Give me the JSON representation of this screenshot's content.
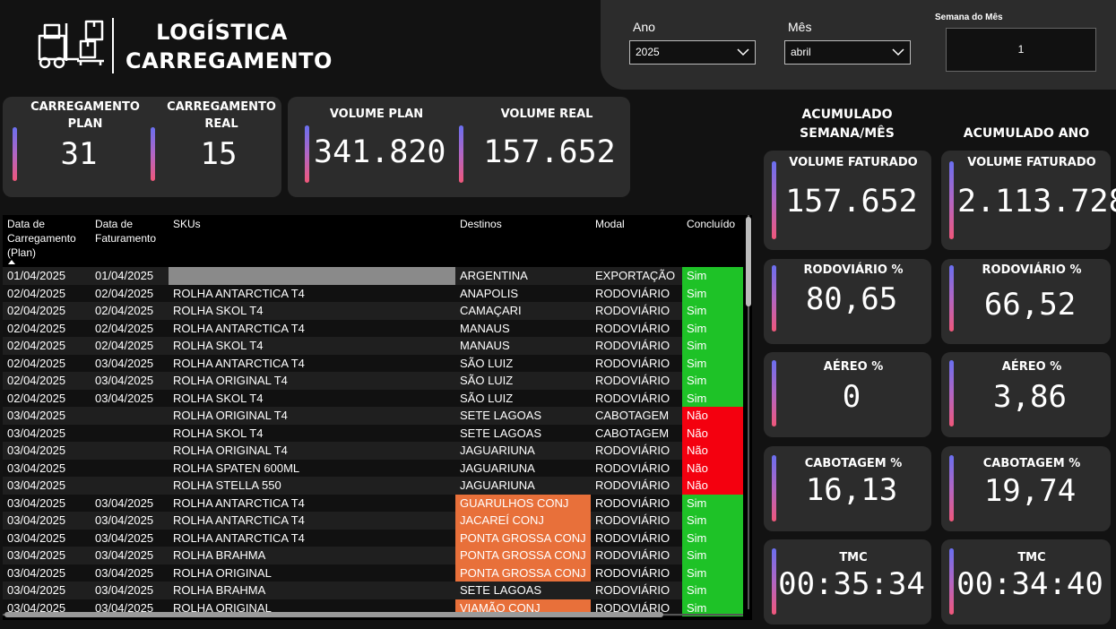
{
  "header": {
    "logo_icon": "forklift-boxes-icon",
    "title_line1": "LOGÍSTICA",
    "title_line2": "CARREGAMENTO"
  },
  "filters": {
    "ano_label": "Ano",
    "ano_value": "2025",
    "mes_label": "Mês",
    "mes_value": "abril",
    "semana_label": "Semana do Mês",
    "semana_value": "1"
  },
  "kpis": {
    "carregamento_plan_label": "CARREGAMENTO PLAN",
    "carregamento_plan_value": "31",
    "carregamento_real_label": "CARREGAMENTO REAL",
    "carregamento_real_value": "15",
    "volume_plan_label": "VOLUME PLAN",
    "volume_plan_value": "341.820",
    "volume_real_label": "VOLUME REAL",
    "volume_real_value": "157.652"
  },
  "acumulado_semana": {
    "heading": "ACUMULADO SEMANA/MÊS",
    "volume_faturado_label": "VOLUME FATURADO",
    "volume_faturado_value": "157.652",
    "rodoviario_label": "RODOVIÁRIO %",
    "rodoviario_value": "80,65",
    "aereo_label": "AÉREO %",
    "aereo_value": "0",
    "cabotagem_label": "CABOTAGEM %",
    "cabotagem_value": "16,13",
    "tmc_label": "TMC",
    "tmc_value": "00:35:34"
  },
  "acumulado_ano": {
    "heading": "ACUMULADO ANO",
    "volume_faturado_label": "VOLUME FATURADO",
    "volume_faturado_value": "2.113.728",
    "rodoviario_label": "RODOVIÁRIO %",
    "rodoviario_value": "66,52",
    "aereo_label": "AÉREO %",
    "aereo_value": "3,86",
    "cabotagem_label": "CABOTAGEM %",
    "cabotagem_value": "19,74",
    "tmc_label": "TMC",
    "tmc_value": "00:34:40"
  },
  "table": {
    "headers": {
      "data_carregamento_line1": "Data de",
      "data_carregamento_line2": "Carregamento",
      "data_carregamento_line3": "(Plan)",
      "data_faturamento_line1": "Data de",
      "data_faturamento_line2": "Faturamento",
      "skus": "SKUs",
      "destinos": "Destinos",
      "modal": "Modal",
      "concluido": "Concluído"
    },
    "colors": {
      "sim": "#1ec227",
      "nao": "#f4000f",
      "conj": "#e8703a",
      "blank_sku": "#8a8a8a"
    },
    "rows": [
      [
        "01/04/2025",
        "01/04/2025",
        "",
        "ARGENTINA",
        "EXPORTAÇÃO",
        "Sim"
      ],
      [
        "02/04/2025",
        "02/04/2025",
        "ROLHA ANTARCTICA T4",
        "ANAPOLIS",
        "RODOVIÁRIO",
        "Sim"
      ],
      [
        "02/04/2025",
        "02/04/2025",
        "ROLHA SKOL T4",
        "CAMAÇARI",
        "RODOVIÁRIO",
        "Sim"
      ],
      [
        "02/04/2025",
        "02/04/2025",
        "ROLHA ANTARCTICA T4",
        "MANAUS",
        "RODOVIÁRIO",
        "Sim"
      ],
      [
        "02/04/2025",
        "02/04/2025",
        "ROLHA SKOL T4",
        "MANAUS",
        "RODOVIÁRIO",
        "Sim"
      ],
      [
        "02/04/2025",
        "03/04/2025",
        "ROLHA ANTARCTICA T4",
        "SÃO LUIZ",
        "RODOVIÁRIO",
        "Sim"
      ],
      [
        "02/04/2025",
        "03/04/2025",
        "ROLHA ORIGINAL T4",
        "SÃO LUIZ",
        "RODOVIÁRIO",
        "Sim"
      ],
      [
        "02/04/2025",
        "03/04/2025",
        "ROLHA SKOL T4",
        "SÃO LUIZ",
        "RODOVIÁRIO",
        "Sim"
      ],
      [
        "03/04/2025",
        "",
        "ROLHA ORIGINAL T4",
        "SETE LAGOAS",
        "CABOTAGEM",
        "Não"
      ],
      [
        "03/04/2025",
        "",
        "ROLHA SKOL T4",
        "SETE LAGOAS",
        "CABOTAGEM",
        "Não"
      ],
      [
        "03/04/2025",
        "",
        "ROLHA ORIGINAL T4",
        "JAGUARIUNA",
        "RODOVIÁRIO",
        "Não"
      ],
      [
        "03/04/2025",
        "",
        "ROLHA SPATEN 600ML",
        "JAGUARIUNA",
        "RODOVIÁRIO",
        "Não"
      ],
      [
        "03/04/2025",
        "",
        "ROLHA STELLA 550",
        "JAGUARIUNA",
        "RODOVIÁRIO",
        "Não"
      ],
      [
        "03/04/2025",
        "03/04/2025",
        "ROLHA ANTARCTICA T4",
        "GUARULHOS CONJ",
        "RODOVIÁRIO",
        "Sim"
      ],
      [
        "03/04/2025",
        "03/04/2025",
        "ROLHA ANTARCTICA T4",
        "JACAREÍ CONJ",
        "RODOVIÁRIO",
        "Sim"
      ],
      [
        "03/04/2025",
        "03/04/2025",
        "ROLHA ANTARCTICA T4",
        "PONTA GROSSA CONJ",
        "RODOVIÁRIO",
        "Sim"
      ],
      [
        "03/04/2025",
        "03/04/2025",
        "ROLHA BRAHMA",
        "PONTA GROSSA CONJ",
        "RODOVIÁRIO",
        "Sim"
      ],
      [
        "03/04/2025",
        "03/04/2025",
        "ROLHA ORIGINAL",
        "PONTA GROSSA CONJ",
        "RODOVIÁRIO",
        "Sim"
      ],
      [
        "03/04/2025",
        "03/04/2025",
        "ROLHA BRAHMA",
        "SETE LAGOAS",
        "RODOVIÁRIO",
        "Sim"
      ],
      [
        "03/04/2025",
        "03/04/2025",
        "ROLHA ORIGINAL",
        "VIAMÃO CONJ",
        "RODOVIÁRIO",
        "Sim"
      ]
    ]
  }
}
